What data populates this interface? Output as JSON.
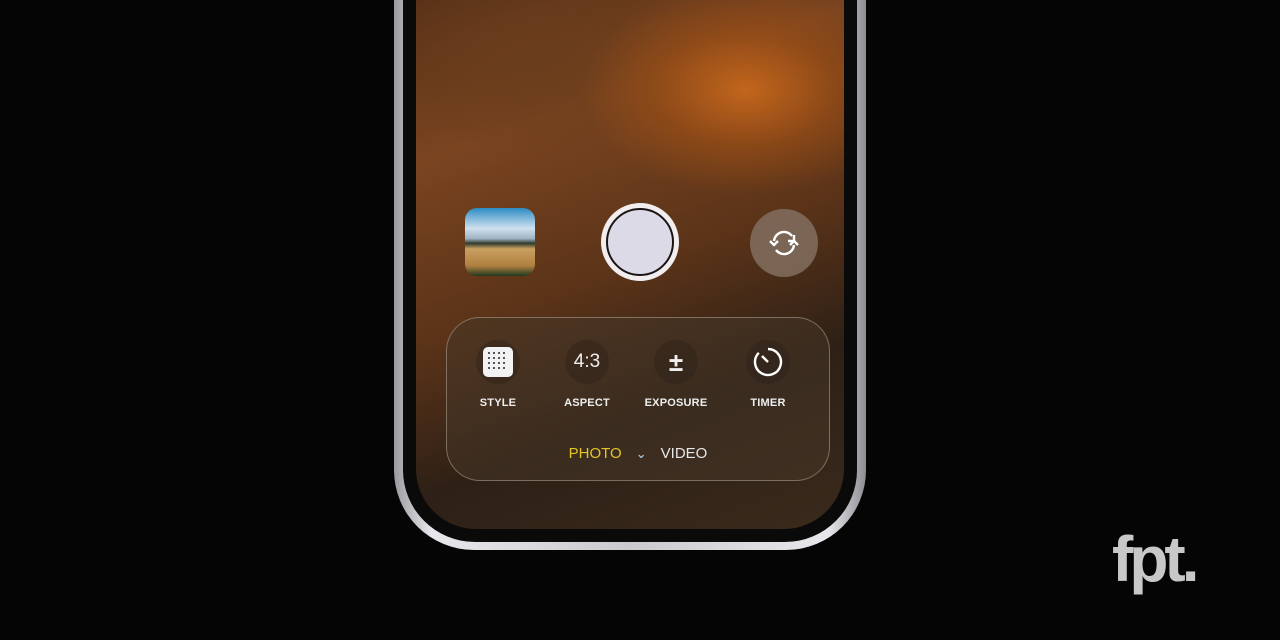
{
  "camera": {
    "controls": [
      {
        "label": "STYLE",
        "icon": "grid-icon"
      },
      {
        "label": "ASPECT",
        "icon": "aspect-ratio",
        "value": "4:3"
      },
      {
        "label": "EXPOSURE",
        "icon": "plus-minus-icon",
        "value": "±"
      },
      {
        "label": "TIMER",
        "icon": "timer-icon"
      }
    ],
    "modes": {
      "active": "PHOTO",
      "other": "VIDEO",
      "separator": "⌄"
    },
    "accent": "#e5c42a"
  },
  "watermark": "fpt."
}
